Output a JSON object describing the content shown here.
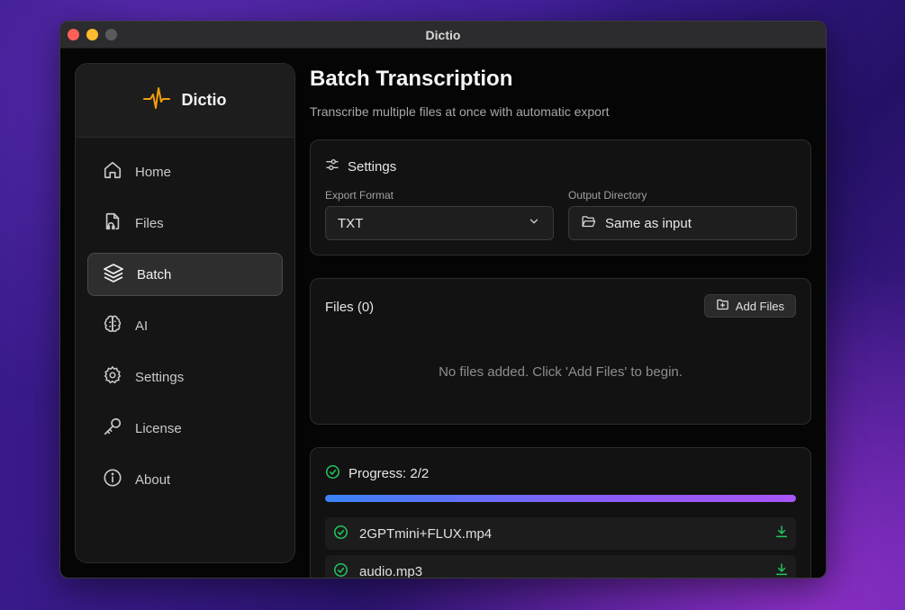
{
  "window": {
    "title": "Dictio"
  },
  "sidebar": {
    "brand": "Dictio",
    "items": [
      {
        "label": "Home",
        "icon": "home-icon",
        "active": false
      },
      {
        "label": "Files",
        "icon": "file-audio-icon",
        "active": false
      },
      {
        "label": "Batch",
        "icon": "layers-icon",
        "active": true
      },
      {
        "label": "AI",
        "icon": "brain-icon",
        "active": false
      },
      {
        "label": "Settings",
        "icon": "gear-icon",
        "active": false
      },
      {
        "label": "License",
        "icon": "key-icon",
        "active": false
      },
      {
        "label": "About",
        "icon": "info-icon",
        "active": false
      }
    ]
  },
  "main": {
    "title": "Batch Transcription",
    "subtitle": "Transcribe multiple files at once with automatic export",
    "settings": {
      "title": "Settings",
      "export_format_label": "Export Format",
      "export_format_value": "TXT",
      "output_dir_label": "Output Directory",
      "output_dir_value": "Same as input"
    },
    "files": {
      "title": "Files (0)",
      "add_label": "Add Files",
      "empty_text": "No files added. Click 'Add Files' to begin."
    },
    "progress": {
      "label": "Progress: 2/2",
      "fraction": 1.0,
      "items": [
        {
          "name": "2GPTmini+FLUX.mp4"
        },
        {
          "name": "audio.mp3"
        }
      ]
    }
  },
  "colors": {
    "accent_orange": "#f59e0b",
    "success_green": "#22c55e",
    "progress_start": "#3b82f6",
    "progress_end": "#a855f7"
  }
}
